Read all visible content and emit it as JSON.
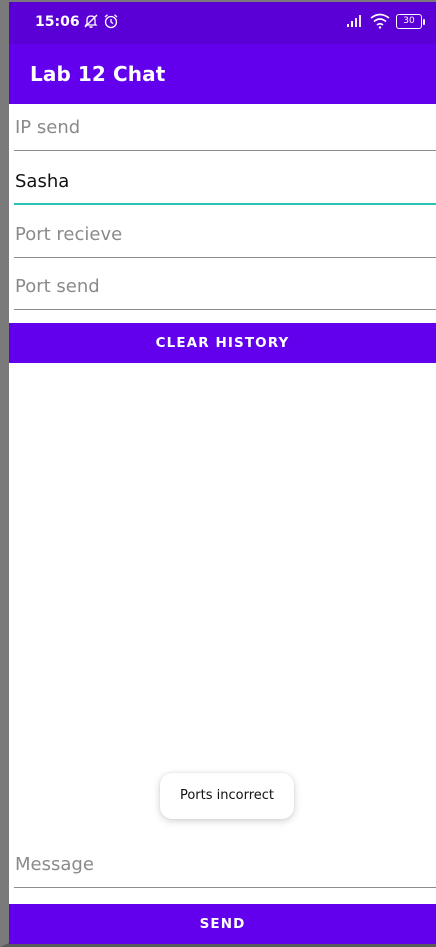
{
  "status_bar": {
    "time": "15:06",
    "battery": "30",
    "icons": [
      "muted-bell-icon",
      "alarm-icon",
      "signal-icon",
      "wifi-icon",
      "battery-icon"
    ]
  },
  "app_bar": {
    "title": "Lab 12 Chat"
  },
  "form": {
    "ip_send": {
      "value": "",
      "placeholder": "IP send"
    },
    "name": {
      "value": "Sasha",
      "placeholder": ""
    },
    "port_receive": {
      "value": "",
      "placeholder": "Port recieve"
    },
    "port_send": {
      "value": "",
      "placeholder": "Port send"
    }
  },
  "clear_button": {
    "label": "CLEAR HISTORY"
  },
  "toast": {
    "text": "Ports incorrect"
  },
  "message": {
    "value": "",
    "placeholder": "Message"
  },
  "send_button": {
    "label": "SEND"
  },
  "colors": {
    "status_bar": "#5a00d6",
    "primary": "#6200ee",
    "focus_underline": "#2bc4b4"
  }
}
